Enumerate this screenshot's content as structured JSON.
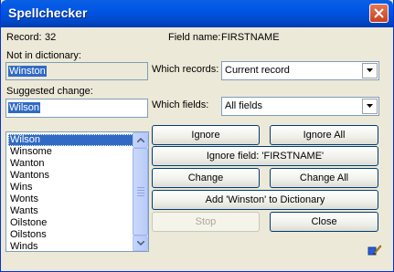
{
  "window": {
    "title": "Spellchecker"
  },
  "record": {
    "label": "Record:",
    "value": "32"
  },
  "field_name": {
    "label": "Field name:",
    "value": "FIRSTNAME"
  },
  "not_in_dictionary": {
    "label": "Not in dictionary:",
    "value": "Winston"
  },
  "suggested_change": {
    "label": "Suggested change:",
    "value": "Wilson"
  },
  "which_records": {
    "label": "Which records:",
    "value": "Current record"
  },
  "which_fields": {
    "label": "Which fields:",
    "value": "All fields"
  },
  "suggestions": [
    "Wilson",
    "Winsome",
    "Wanton",
    "Wantons",
    "Wins",
    "Wonts",
    "Wants",
    "Oilstone",
    "Oilstons",
    "Winds"
  ],
  "buttons": {
    "ignore": "Ignore",
    "ignore_all": "Ignore All",
    "ignore_field": "Ignore field: 'FIRSTNAME'",
    "change": "Change",
    "change_all": "Change All",
    "add_to_dictionary": "Add 'Winston' to Dictionary",
    "stop": "Stop",
    "close": "Close"
  },
  "icons": {
    "close": "close-icon",
    "dropdown": "chevron-down-icon",
    "scroll_up": "chevron-up-icon",
    "scroll_down": "chevron-down-icon",
    "edit": "pencil-icon"
  }
}
